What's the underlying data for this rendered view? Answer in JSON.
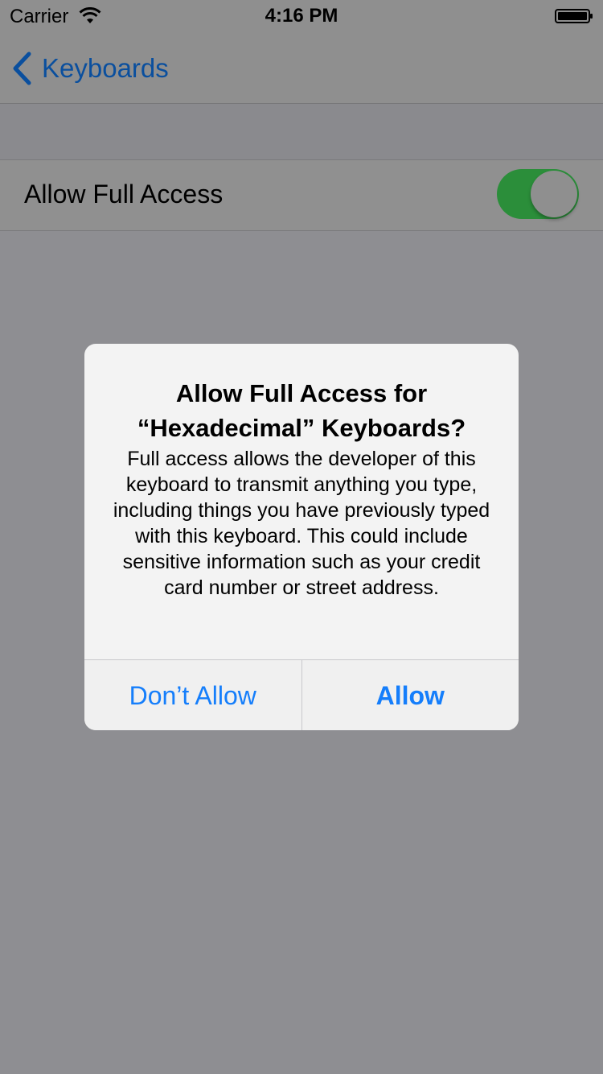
{
  "status_bar": {
    "carrier": "Carrier",
    "time": "4:16 PM",
    "wifi_icon": "wifi-icon",
    "battery_icon": "battery-icon"
  },
  "nav": {
    "back_label": "Keyboards",
    "back_icon": "chevron-left-icon"
  },
  "settings": {
    "row_label": "Allow Full Access",
    "toggle_on": true
  },
  "alert": {
    "title": "Allow Full Access for “Hexadecimal” Keyboards?",
    "message": "Full access allows the developer of this keyboard to transmit anything you type, including things you have previously typed with this keyboard. This could include sensitive information such as your credit card number or street address.",
    "cancel_label": "Don’t Allow",
    "confirm_label": "Allow"
  },
  "colors": {
    "dim_background": "#8e8e92",
    "link_blue": "#157efb",
    "toggle_green": "#2b8e3a"
  }
}
